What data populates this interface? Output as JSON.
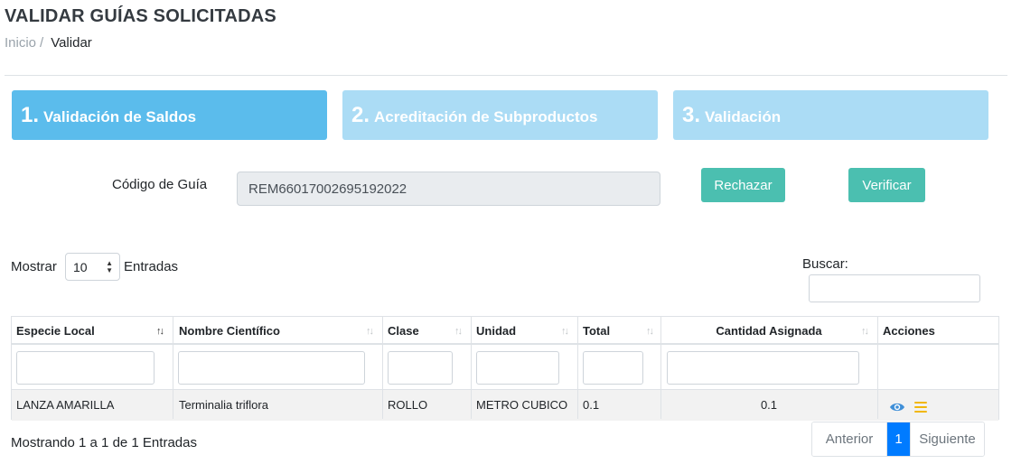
{
  "page": {
    "title": "VALIDAR GUÍAS SOLICITADAS",
    "breadcrumb": {
      "home": "Inicio",
      "separator": "/",
      "current": "Validar"
    }
  },
  "steps": [
    {
      "num": "1.",
      "label": "Validación de Saldos",
      "active": true
    },
    {
      "num": "2.",
      "label": "Acreditación de Subproductos",
      "active": false
    },
    {
      "num": "3.",
      "label": "Validación",
      "active": false
    }
  ],
  "guide": {
    "label": "Código de Guía",
    "value": "REM66017002695192022"
  },
  "actions": {
    "reject": "Rechazar",
    "verify": "Verificar"
  },
  "table_controls": {
    "show_label": "Mostrar",
    "entries_label": "Entradas",
    "page_length": "10",
    "search_label": "Buscar:"
  },
  "table": {
    "columns": [
      "Especie Local",
      "Nombre Científico",
      "Clase",
      "Unidad",
      "Total",
      "Cantidad Asignada",
      "Acciones"
    ],
    "rows": [
      [
        "LANZA AMARILLA",
        "Terminalia triflora",
        "ROLLO",
        "METRO CUBICO",
        "0.1",
        "0.1"
      ]
    ]
  },
  "info": "Mostrando 1 a 1 de 1 Entradas",
  "pagination": {
    "prev": "Anterior",
    "current": "1",
    "next": "Siguiente"
  },
  "colors": {
    "step_active": "#5bbcec",
    "step_inactive": "#abdcf5",
    "teal": "#4bbfb0",
    "primary": "#007bff",
    "warning": "#f1b70b"
  },
  "icons": {
    "view": "eye-icon",
    "detail": "menu-icon"
  }
}
